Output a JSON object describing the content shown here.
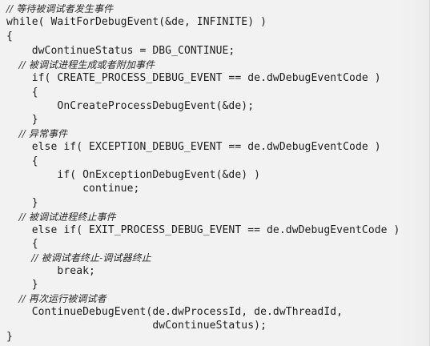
{
  "code": {
    "lines": [
      {
        "text": "// 等待被调试者发生事件",
        "kind": "comment"
      },
      {
        "text": "while( WaitForDebugEvent(&de, INFINITE) )",
        "kind": "code"
      },
      {
        "text": "{",
        "kind": "code"
      },
      {
        "text": "    dwContinueStatus = DBG_CONTINUE;",
        "kind": "code"
      },
      {
        "text": "    // 被调试进程生成或者附加事件",
        "kind": "comment"
      },
      {
        "text": "    if( CREATE_PROCESS_DEBUG_EVENT == de.dwDebugEventCode )",
        "kind": "code"
      },
      {
        "text": "    {",
        "kind": "code"
      },
      {
        "text": "        OnCreateProcessDebugEvent(&de);",
        "kind": "code"
      },
      {
        "text": "    }",
        "kind": "code"
      },
      {
        "text": "    // 异常事件",
        "kind": "comment"
      },
      {
        "text": "    else if( EXCEPTION_DEBUG_EVENT == de.dwDebugEventCode )",
        "kind": "code"
      },
      {
        "text": "    {",
        "kind": "code"
      },
      {
        "text": "        if( OnExceptionDebugEvent(&de) )",
        "kind": "code"
      },
      {
        "text": "            continue;",
        "kind": "code"
      },
      {
        "text": "    }",
        "kind": "code"
      },
      {
        "text": "    // 被调试进程终止事件",
        "kind": "comment"
      },
      {
        "text": "    else if( EXIT_PROCESS_DEBUG_EVENT == de.dwDebugEventCode )",
        "kind": "code"
      },
      {
        "text": "    {",
        "kind": "code"
      },
      {
        "text": "        // 被调试者终止-调试器终止",
        "kind": "comment"
      },
      {
        "text": "        break;",
        "kind": "code"
      },
      {
        "text": "    }",
        "kind": "code"
      },
      {
        "text": "    // 再次运行被调试者",
        "kind": "comment"
      },
      {
        "text": "    ContinueDebugEvent(de.dwProcessId, de.dwThreadId,",
        "kind": "code"
      },
      {
        "text": "                       dwContinueStatus);",
        "kind": "code"
      },
      {
        "text": "}",
        "kind": "code"
      }
    ]
  }
}
